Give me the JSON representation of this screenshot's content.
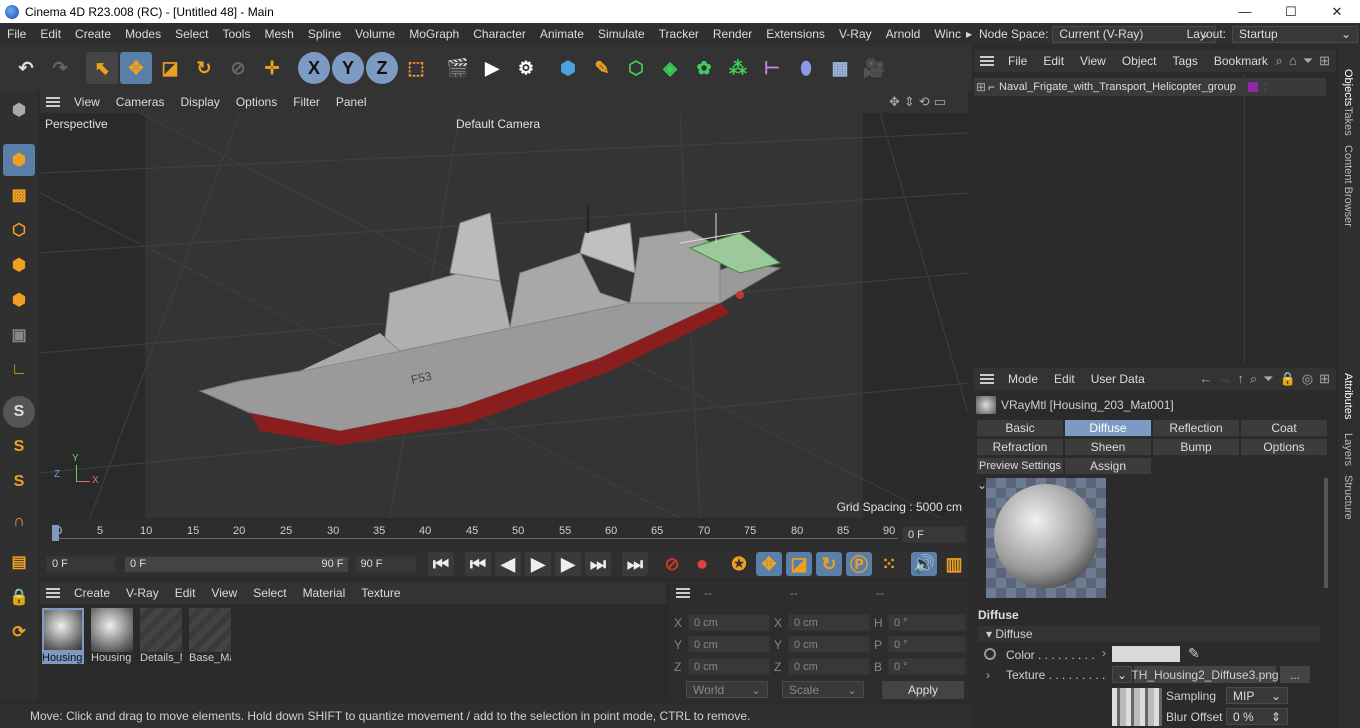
{
  "window": {
    "title": "Cinema 4D R23.008 (RC) - [Untitled 48] - Main",
    "min": "—",
    "max": "☐",
    "close": "✕"
  },
  "menu": {
    "items": [
      "File",
      "Edit",
      "Create",
      "Modes",
      "Select",
      "Tools",
      "Mesh",
      "Spline",
      "Volume",
      "MoGraph",
      "Character",
      "Animate",
      "Simulate",
      "Tracker",
      "Render",
      "Extensions",
      "V-Ray",
      "Arnold",
      "Winc"
    ],
    "more": "▸",
    "node_space_label": "Node Space:",
    "node_space_value": "Current (V-Ray)",
    "layout_label": "Layout:",
    "layout_value": "Startup"
  },
  "viewport": {
    "menu": [
      "View",
      "Cameras",
      "Display",
      "Options",
      "Filter",
      "Panel"
    ],
    "label": "Perspective",
    "camera": "Default Camera",
    "grid_spacing": "Grid Spacing : 5000 cm",
    "hull_marking": "F53",
    "axis_x": "X",
    "axis_y": "Y",
    "axis_z": "Z"
  },
  "timeline": {
    "ticks": [
      "0",
      "5",
      "10",
      "15",
      "20",
      "25",
      "30",
      "35",
      "40",
      "45",
      "50",
      "55",
      "60",
      "65",
      "70",
      "75",
      "80",
      "85",
      "90"
    ],
    "current_frame": "0 F"
  },
  "transport": {
    "start": "0 F",
    "range_start": "0 F",
    "range_end": "90 F",
    "end": "90 F"
  },
  "materials": {
    "menu": [
      "Create",
      "V-Ray",
      "Edit",
      "View",
      "Select",
      "Material",
      "Texture"
    ],
    "items": [
      "Housing",
      "Housing",
      "Details_M",
      "Base_Ma"
    ]
  },
  "coords": {
    "header": [
      "--",
      "--",
      "--"
    ],
    "rows": [
      {
        "a": "X",
        "av": "0 cm",
        "b": "X",
        "bv": "0 cm",
        "c": "H",
        "cv": "0 °"
      },
      {
        "a": "Y",
        "av": "0 cm",
        "b": "Y",
        "bv": "0 cm",
        "c": "P",
        "cv": "0 °"
      },
      {
        "a": "Z",
        "av": "0 cm",
        "b": "Z",
        "bv": "0 cm",
        "c": "B",
        "cv": "0 °"
      }
    ],
    "world": "World",
    "scale": "Scale",
    "apply": "Apply"
  },
  "objects": {
    "menu": [
      "File",
      "Edit",
      "View",
      "Object",
      "Tags",
      "Bookmarks"
    ],
    "item": "Naval_Frigate_with_Transport_Helicopter_group"
  },
  "attributes": {
    "menu": [
      "Mode",
      "Edit",
      "User Data"
    ],
    "material_title": "VRayMtl [Housing_203_Mat001]",
    "tabs_row1": [
      "Basic",
      "Diffuse",
      "Reflection",
      "Coat"
    ],
    "tabs_row2": [
      "Refraction",
      "Sheen",
      "Bump",
      "Options"
    ],
    "tabs_row3": [
      "Preview Settings",
      "Assign"
    ],
    "section": "Diffuse",
    "subsection": "▾ Diffuse",
    "color_label": "Color . . . . . . . . .",
    "texture_label": "Texture . . . . . . . . .",
    "texture_file": "TH_Housing2_Diffuse3.png",
    "more_button": "...",
    "sampling_label": "Sampling",
    "sampling_value": "MIP",
    "blur_label": "Blur Offset",
    "blur_value": "0 %"
  },
  "right_tabs": [
    "Objects",
    "Takes",
    "Content Browser",
    "Attributes",
    "Layers",
    "Structure"
  ],
  "status": "Move: Click and drag to move elements. Hold down SHIFT to quantize movement / add to the selection in point mode, CTRL to remove.",
  "colors": {
    "accent": "#7d9bc2",
    "orange": "#f0a020",
    "bg": "#2b2b2b"
  }
}
